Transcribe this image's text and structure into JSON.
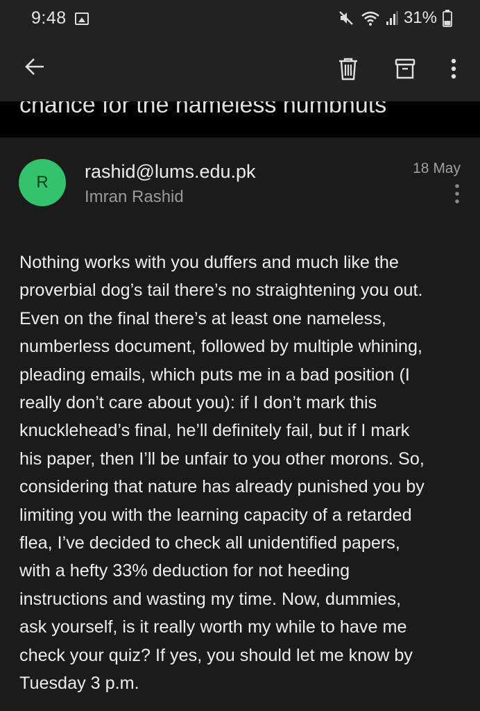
{
  "status_bar": {
    "time": "9:48",
    "battery": "31%",
    "icons": [
      "gallery-icon",
      "mute-icon",
      "wifi-icon",
      "signal-icon",
      "battery-icon"
    ]
  },
  "toolbar": {
    "icons": [
      "back-arrow-icon",
      "delete-icon",
      "archive-icon",
      "more-vert-icon"
    ]
  },
  "subject": {
    "text": "chance for the nameless numbnuts"
  },
  "message": {
    "avatar_letter": "R",
    "avatar_color": "#32c36c",
    "sender_email": "rashid@lums.edu.pk",
    "sender_name": "Imran Rashid",
    "date": "18 May",
    "body_lines": [
      "Nothing works with you duffers and much like the",
      "proverbial dog’s tail there’s no straightening you out.",
      "Even on the final there’s at least one nameless,",
      "numberless document, followed by multiple whining,",
      "pleading emails, which puts me in a bad position (I",
      "really don’t care about you): if I don’t mark this",
      "knucklehead’s final, he’ll definitely fail, but if I mark",
      "his paper, then I’ll be unfair to you other morons. So,",
      "considering that nature has already punished you by",
      "limiting you with the learning capacity of a retarded",
      "flea, I’ve decided to check all unidentified papers,",
      "with a hefty 33% deduction for not heeding",
      "instructions and wasting my time. Now, dummies,",
      "ask yourself, is it really worth my while to have me",
      "check your quiz? If yes, you should let me know by",
      "Tuesday 3 p.m."
    ]
  }
}
